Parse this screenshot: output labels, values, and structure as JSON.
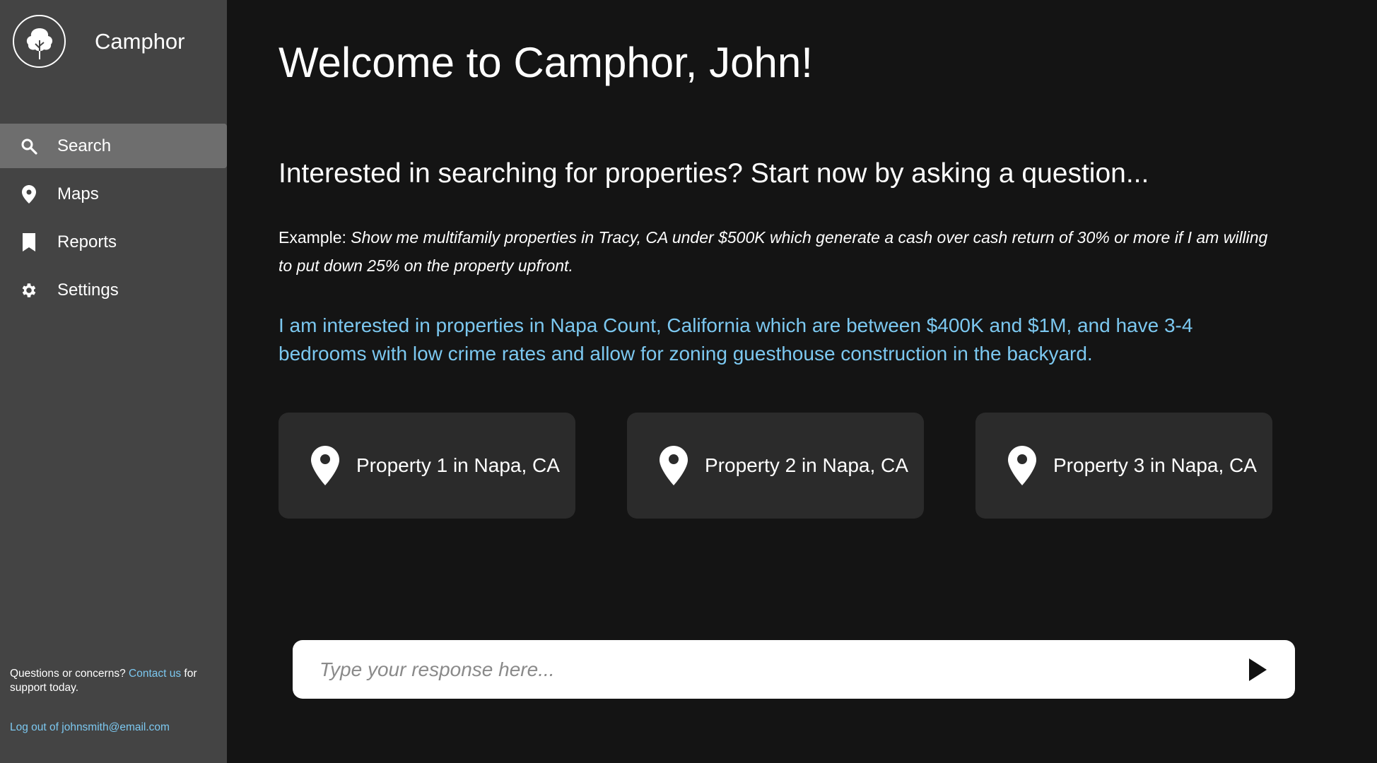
{
  "brand": {
    "name": "Camphor"
  },
  "sidebar": {
    "items": [
      {
        "label": "Search",
        "icon": "search-icon",
        "active": true
      },
      {
        "label": "Maps",
        "icon": "map-pin-icon",
        "active": false
      },
      {
        "label": "Reports",
        "icon": "bookmark-icon",
        "active": false
      },
      {
        "label": "Settings",
        "icon": "gear-icon",
        "active": false
      }
    ],
    "support": {
      "prefix": "Questions or concerns? ",
      "link": "Contact us",
      "suffix": " for support today."
    },
    "logout": "Log out of johnsmith@email.com"
  },
  "main": {
    "welcome": "Welcome to Camphor, John!",
    "heading": "Interested in searching for properties? Start now by asking a question...",
    "example_label": "Example: ",
    "example_text": "Show me multifamily properties in Tracy, CA under $500K which generate a cash over cash return of 30% or more if I am willing to put down 25% on the property upfront.",
    "user_query": "I am interested in properties in Napa Count, California which are between $400K and $1M, and have 3-4 bedrooms with low crime rates and allow for zoning guesthouse construction in the backyard.",
    "properties": [
      {
        "label": "Property 1 in Napa, CA"
      },
      {
        "label": "Property 2 in Napa, CA"
      },
      {
        "label": "Property 3 in Napa, CA"
      }
    ]
  },
  "input": {
    "placeholder": "Type your response here...",
    "value": ""
  },
  "colors": {
    "background": "#141414",
    "sidebar": "#444444",
    "active_nav": "#6e6e6e",
    "card": "#2b2b2b",
    "accent": "#7cc8f0"
  }
}
